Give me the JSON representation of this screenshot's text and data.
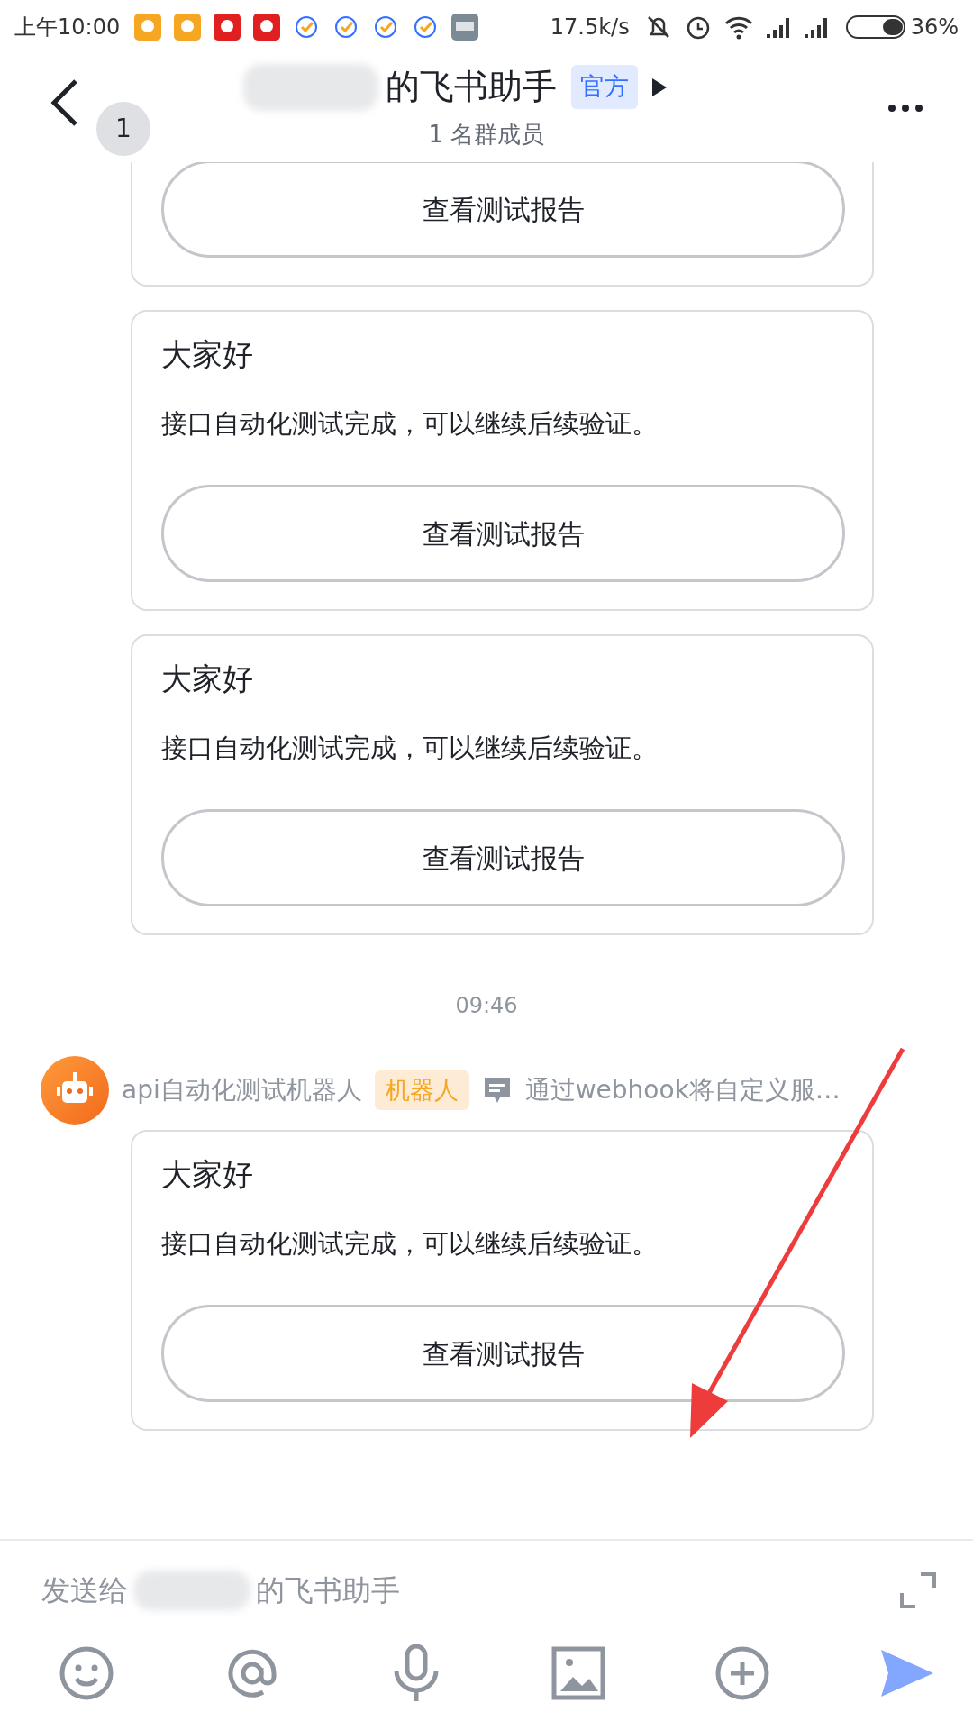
{
  "status_bar": {
    "time": "上午10:00",
    "net_speed": "17.5k/s",
    "battery": "36%"
  },
  "header": {
    "avatar_text": "1",
    "title": "的飞书助手",
    "badge": "官方",
    "subtitle": "1 名群成员"
  },
  "messages": [
    {
      "kind": "card",
      "button": "查看测试报告"
    },
    {
      "kind": "card",
      "title": "大家好",
      "body": "接口自动化测试完成，可以继续后续验证。",
      "button": "查看测试报告"
    },
    {
      "kind": "card",
      "title": "大家好",
      "body": "接口自动化测试完成，可以继续后续验证。",
      "button": "查看测试报告"
    },
    {
      "kind": "time",
      "text": "09:46"
    },
    {
      "kind": "sender",
      "name": "api自动化测试机器人",
      "tag": "机器人",
      "description": "通过webhook将自定义服…"
    },
    {
      "kind": "card",
      "title": "大家好",
      "body": "接口自动化测试完成，可以继续后续验证。",
      "button": "查看测试报告"
    }
  ],
  "composer": {
    "hint_before": "发送给",
    "hint_after": "的飞书助手"
  }
}
